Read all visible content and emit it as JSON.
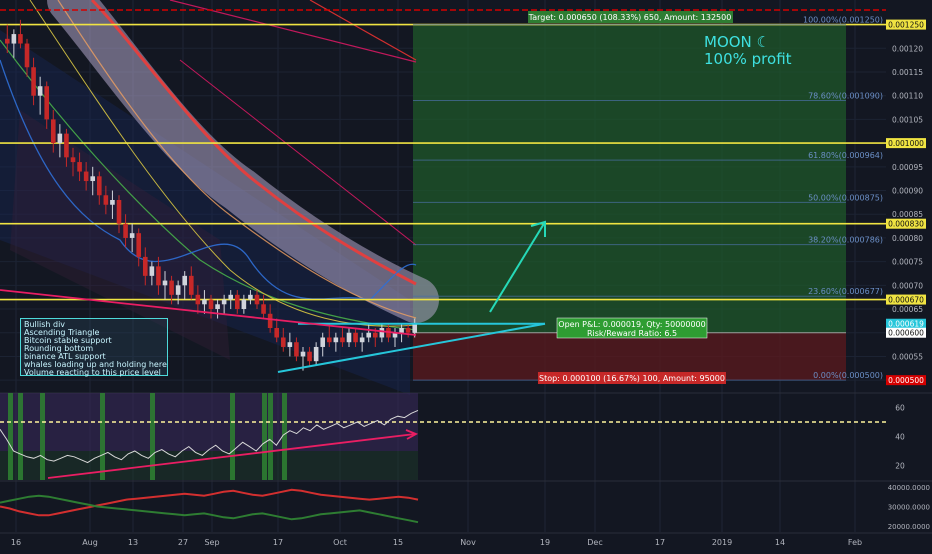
{
  "chart_data": [
    {
      "type": "candlestick",
      "price_axis": {
        "ticks": [
          "0.00125",
          "0.00120",
          "0.00115",
          "0.00110",
          "0.00105",
          "0.00100",
          "0.00095",
          "0.00090",
          "0.00085",
          "0.00080",
          "0.00075",
          "0.00070",
          "0.00065",
          "0.00060",
          "0.00055",
          "0.00050"
        ],
        "tick_values": [
          0.00125,
          0.0012,
          0.00115,
          0.0011,
          0.00105,
          0.001,
          0.00095,
          0.0009,
          0.00085,
          0.0008,
          0.00075,
          0.0007,
          0.00065,
          0.0006,
          0.00055,
          0.0005
        ],
        "range": [
          0.000475,
          0.001285
        ]
      },
      "time_axis": {
        "labels": [
          "16",
          "Aug",
          "13",
          "27",
          "Sep",
          "17",
          "Oct",
          "15",
          "Nov",
          "19",
          "Dec",
          "17",
          "2019",
          "14",
          "Feb"
        ]
      },
      "price_tags": [
        {
          "text": "0.001250",
          "value": 0.00125,
          "color": "#f0e442"
        },
        {
          "text": "0.001000",
          "value": 0.001,
          "color": "#f0e442"
        },
        {
          "text": "0.000830",
          "value": 0.00083,
          "color": "#f0e442"
        },
        {
          "text": "0.000670",
          "value": 0.00067,
          "color": "#f0e442"
        },
        {
          "text": "0.000619",
          "value": 0.000619,
          "color": "#26c6da"
        },
        {
          "text": "0.000600",
          "value": 0.0006,
          "color": "#ffffff"
        },
        {
          "text": "0.000500",
          "value": 0.0005,
          "color": "#d50000"
        }
      ],
      "fib_levels": [
        {
          "label": "100.00%(0.001250)",
          "value": 0.00125
        },
        {
          "label": "78.60%(0.001090)",
          "value": 0.00109
        },
        {
          "label": "61.80%(0.000964)",
          "value": 0.000964
        },
        {
          "label": "50.00%(0.000875)",
          "value": 0.000875
        },
        {
          "label": "38.20%(0.000786)",
          "value": 0.000786
        },
        {
          "label": "23.60%(0.000677)",
          "value": 0.000677
        },
        {
          "label": "0.00%(0.000500)",
          "value": 0.0005
        }
      ],
      "horizontal_lines": [
        0.00125,
        0.001,
        0.00083,
        0.00067
      ],
      "position": {
        "entry": 0.0006,
        "target": 0.00125,
        "stop": 0.0005,
        "target_label": "Target: 0.000650 (108.33%) 650, Amount: 132500",
        "pnl_label": "Open P&L: 0.000019, Qty: 50000000",
        "rr_label": "Risk/Reward Ratio: 6.5",
        "stop_label": "Stop: 0.000100 (16.67%) 100, Amount: 95000"
      },
      "candles_ohlc": [
        [
          0.00122,
          0.00125,
          0.00119,
          0.00121
        ],
        [
          0.00121,
          0.00124,
          0.00118,
          0.00123
        ],
        [
          0.00123,
          0.00126,
          0.0012,
          0.00121
        ],
        [
          0.00121,
          0.00122,
          0.00114,
          0.00116
        ],
        [
          0.00116,
          0.00118,
          0.00108,
          0.0011
        ],
        [
          0.0011,
          0.00114,
          0.00106,
          0.00112
        ],
        [
          0.00112,
          0.00113,
          0.00103,
          0.00105
        ],
        [
          0.00105,
          0.00107,
          0.00098,
          0.001
        ],
        [
          0.001,
          0.00104,
          0.00097,
          0.00102
        ],
        [
          0.00102,
          0.00103,
          0.00095,
          0.00097
        ],
        [
          0.00097,
          0.00099,
          0.00093,
          0.00096
        ],
        [
          0.00096,
          0.00098,
          0.00092,
          0.00094
        ],
        [
          0.00094,
          0.00096,
          0.0009,
          0.00092
        ],
        [
          0.00092,
          0.00095,
          0.00089,
          0.00093
        ],
        [
          0.00093,
          0.00094,
          0.00087,
          0.00089
        ],
        [
          0.00089,
          0.00091,
          0.00085,
          0.00087
        ],
        [
          0.00087,
          0.0009,
          0.00084,
          0.00088
        ],
        [
          0.00088,
          0.00089,
          0.00081,
          0.00083
        ],
        [
          0.00083,
          0.00085,
          0.00078,
          0.0008
        ],
        [
          0.0008,
          0.00083,
          0.00077,
          0.00081
        ],
        [
          0.00081,
          0.00082,
          0.00074,
          0.00076
        ],
        [
          0.00076,
          0.00078,
          0.0007,
          0.00072
        ],
        [
          0.00072,
          0.00075,
          0.0007,
          0.00074
        ],
        [
          0.00074,
          0.00076,
          0.00068,
          0.0007
        ],
        [
          0.0007,
          0.00073,
          0.00067,
          0.00071
        ],
        [
          0.00071,
          0.00072,
          0.00066,
          0.00068
        ],
        [
          0.00068,
          0.00071,
          0.00066,
          0.0007
        ],
        [
          0.0007,
          0.00073,
          0.00067,
          0.00072
        ],
        [
          0.00072,
          0.00074,
          0.00067,
          0.00068
        ],
        [
          0.00068,
          0.0007,
          0.00064,
          0.00066
        ],
        [
          0.00066,
          0.00069,
          0.00064,
          0.00067
        ],
        [
          0.00067,
          0.00068,
          0.00063,
          0.00065
        ],
        [
          0.00065,
          0.00067,
          0.00063,
          0.00066
        ],
        [
          0.00066,
          0.00068,
          0.00064,
          0.00067
        ],
        [
          0.00067,
          0.00069,
          0.00065,
          0.00068
        ],
        [
          0.00068,
          0.00069,
          0.00064,
          0.00065
        ],
        [
          0.00065,
          0.00068,
          0.00064,
          0.00067
        ],
        [
          0.00067,
          0.00069,
          0.00066,
          0.00068
        ],
        [
          0.00068,
          0.00069,
          0.00065,
          0.00066
        ],
        [
          0.00066,
          0.00068,
          0.00063,
          0.00064
        ],
        [
          0.00064,
          0.00066,
          0.0006,
          0.00061
        ],
        [
          0.00061,
          0.00063,
          0.00058,
          0.00059
        ],
        [
          0.00059,
          0.00061,
          0.00056,
          0.00057
        ],
        [
          0.00057,
          0.0006,
          0.00055,
          0.00058
        ],
        [
          0.00058,
          0.00059,
          0.00054,
          0.00055
        ],
        [
          0.00055,
          0.00057,
          0.00052,
          0.00056
        ],
        [
          0.00056,
          0.00057,
          0.00053,
          0.00054
        ],
        [
          0.00054,
          0.00058,
          0.00053,
          0.00057
        ],
        [
          0.00057,
          0.0006,
          0.00055,
          0.00059
        ],
        [
          0.00059,
          0.00062,
          0.00057,
          0.00058
        ],
        [
          0.00058,
          0.0006,
          0.00056,
          0.00059
        ],
        [
          0.00059,
          0.00061,
          0.00057,
          0.00058
        ],
        [
          0.00058,
          0.00061,
          0.00057,
          0.0006
        ],
        [
          0.0006,
          0.00061,
          0.00057,
          0.00058
        ],
        [
          0.00058,
          0.0006,
          0.00056,
          0.00059
        ],
        [
          0.00059,
          0.00062,
          0.00058,
          0.0006
        ],
        [
          0.0006,
          0.00061,
          0.00057,
          0.00059
        ],
        [
          0.00059,
          0.00062,
          0.00058,
          0.00061
        ],
        [
          0.00061,
          0.00062,
          0.00058,
          0.00059
        ],
        [
          0.00059,
          0.00061,
          0.00057,
          0.0006
        ],
        [
          0.0006,
          0.00062,
          0.00058,
          0.00061
        ],
        [
          0.00061,
          0.00062,
          0.00059,
          0.0006
        ],
        [
          0.0006,
          0.00063,
          0.00059,
          0.00062
        ]
      ],
      "annotation_lines": [
        "Bullish div",
        "Ascending Triangle",
        "Bitcoin stable support",
        "Rounding bottom",
        "binance ATL support",
        "whales loading up and holding here",
        "Volume reacting to this price level"
      ],
      "note_title": "MOON ☾",
      "note_subtitle": "100% profit"
    },
    {
      "type": "line",
      "oscillator_ticks": [
        "60",
        "40",
        "20"
      ],
      "oscillator_tick_values": [
        60,
        40,
        20
      ],
      "oscillator_range": [
        10,
        70
      ],
      "oscillator_dashed_level": 50,
      "oscillator_values": [
        45,
        38,
        30,
        28,
        26,
        25,
        27,
        24,
        23,
        25,
        27,
        26,
        24,
        22,
        25,
        27,
        29,
        26,
        24,
        28,
        30,
        27,
        25,
        29,
        31,
        28,
        26,
        30,
        33,
        29,
        27,
        31,
        34,
        30,
        28,
        32,
        36,
        33,
        30,
        35,
        38,
        34,
        41,
        44,
        42,
        46,
        44,
        48,
        45,
        47,
        49,
        46,
        48,
        50,
        47,
        49,
        51,
        48,
        52,
        54,
        53,
        56,
        58
      ],
      "colors": {
        "oscillator": "#d8d8d8",
        "divergence": "#e91e63",
        "histogram": "#2e7d32",
        "zone": "#3a2a5c"
      }
    },
    {
      "type": "line",
      "ticks": [
        "40000.0000",
        "30000.0000",
        "20000.0000"
      ],
      "tick_values": [
        40000,
        30000,
        20000
      ],
      "range": [
        17000,
        43000
      ],
      "series": [
        {
          "color": "#d32f2f",
          "values": [
            30000,
            29000,
            27500,
            26500,
            25500,
            25500,
            26500,
            27500,
            28500,
            29500,
            30500,
            31500,
            32500,
            33500,
            34000,
            34500,
            35000,
            35500,
            36000,
            36500,
            36000,
            35500,
            36500,
            37500,
            38000,
            37000,
            36000,
            35500,
            36500,
            37500,
            38500,
            38000,
            37000,
            36000,
            35500,
            35000,
            34500,
            34000,
            33500,
            34000,
            34500,
            35000,
            34500,
            33500
          ]
        },
        {
          "color": "#2e7d32",
          "values": [
            32000,
            33000,
            34000,
            35000,
            35500,
            35000,
            34000,
            33000,
            32000,
            31000,
            30000,
            29500,
            29000,
            28500,
            28000,
            27500,
            27000,
            26500,
            26000,
            25500,
            26000,
            26500,
            25500,
            24500,
            24000,
            25000,
            26000,
            26500,
            25500,
            24500,
            23500,
            24000,
            25000,
            26000,
            26500,
            27000,
            27500,
            28000,
            27000,
            26000,
            25000,
            24000,
            23000,
            22000
          ]
        }
      ]
    }
  ]
}
